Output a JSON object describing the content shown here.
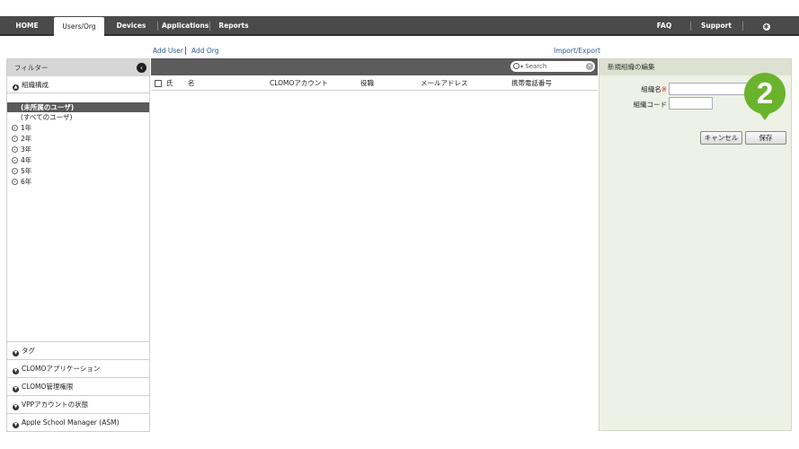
{
  "nav": {
    "items": [
      {
        "label": "HOME"
      },
      {
        "label": "Users/Org"
      },
      {
        "label": "Devices"
      },
      {
        "label": "Applications"
      },
      {
        "label": "Reports"
      }
    ],
    "right": [
      {
        "label": "FAQ"
      },
      {
        "label": "Support"
      },
      {
        "label": "Settings",
        "icon": "gear-icon"
      }
    ]
  },
  "actions": {
    "add_user": "Add User",
    "add_org": "Add Org",
    "import_export": "Import/Export"
  },
  "filter": {
    "title": "フィルター",
    "org_section": "組織構成",
    "tree": {
      "selected": "(未所属のユーザ)",
      "all": "(すべてのユーザ)",
      "grades": [
        "1年",
        "2年",
        "3年",
        "4年",
        "5年",
        "6年"
      ]
    },
    "bottom_sections": [
      "タグ",
      "CLOMOアプリケーション",
      "CLOMO管理権限",
      "VPPアカウントの状態",
      "Apple School Manager (ASM)"
    ]
  },
  "search": {
    "placeholder": "Search"
  },
  "table": {
    "columns": [
      "氏",
      "名",
      "CLOMOアカウント",
      "役職",
      "メールアドレス",
      "携帯電話番号"
    ]
  },
  "edit_panel": {
    "title": "新規組織の編集",
    "name_label": "組織名",
    "required_mark": "※",
    "code_label": "組織コード",
    "name_value": "",
    "code_value": "",
    "cancel": "キャンセル",
    "save": "保存"
  },
  "callout": {
    "number": "2",
    "color": "#6ab42d"
  }
}
